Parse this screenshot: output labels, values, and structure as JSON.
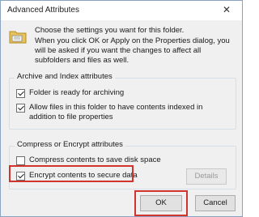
{
  "window": {
    "title": "Advanced Attributes",
    "close_glyph": "✕"
  },
  "intro": {
    "line1": "Choose the settings you want for this folder.",
    "line2": "When you click OK or Apply on the Properties dialog, you will be asked if you want the changes to affect all subfolders and files as well."
  },
  "archive_group": {
    "title": "Archive and Index attributes",
    "items": [
      {
        "label": "Folder is ready for archiving",
        "checked": true
      },
      {
        "label": "Allow files in this folder to have contents indexed in addition to file properties",
        "checked": true
      }
    ]
  },
  "encrypt_group": {
    "title": "Compress or Encrypt attributes",
    "items": [
      {
        "label": "Compress contents to save disk space",
        "checked": false
      },
      {
        "label": "Encrypt contents to secure data",
        "checked": true
      }
    ],
    "details_label": "Details"
  },
  "buttons": {
    "ok": "OK",
    "cancel": "Cancel"
  },
  "colors": {
    "highlight": "#d0342c",
    "folder": "#e8c25a"
  },
  "icons": {
    "folder": "folder-icon",
    "close": "close-icon"
  }
}
